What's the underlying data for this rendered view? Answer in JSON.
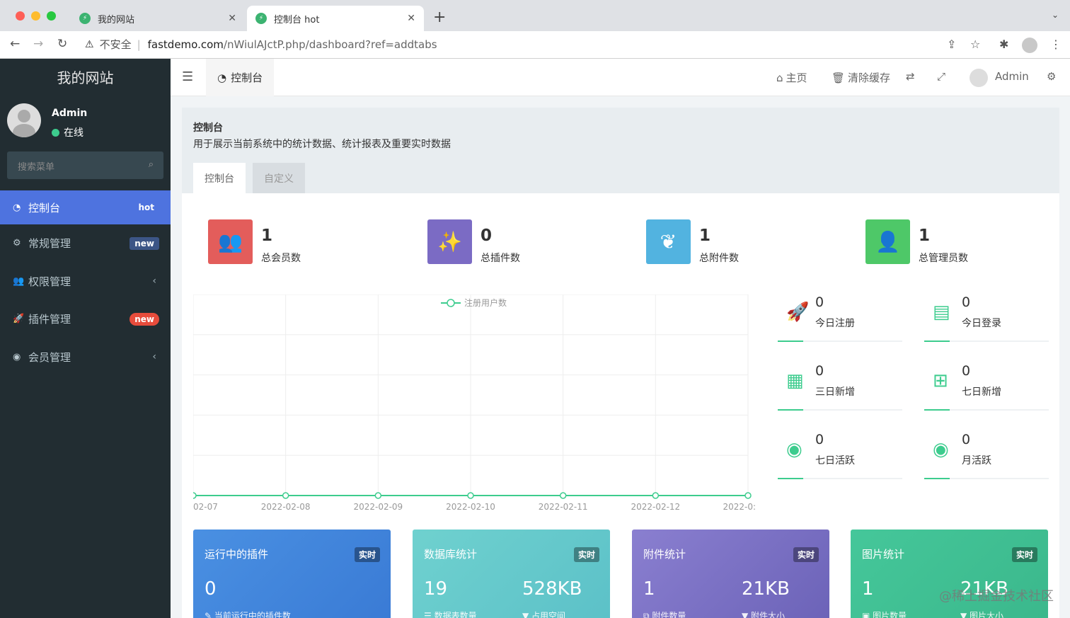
{
  "browser": {
    "tabs": [
      {
        "title": "我的网站"
      },
      {
        "title": "控制台 hot"
      }
    ],
    "url_insecure": "不安全",
    "url_domain": "fastdemo.com",
    "url_path": "/nWiulAJctP.php/dashboard?ref=addtabs"
  },
  "sidebar": {
    "logo": "我的网站",
    "user_name": "Admin",
    "user_status": "在线",
    "search_placeholder": "搜索菜单",
    "items": [
      {
        "label": "控制台",
        "badge": "hot"
      },
      {
        "label": "常规管理",
        "badge": "new"
      },
      {
        "label": "权限管理"
      },
      {
        "label": "插件管理",
        "badge": "new"
      },
      {
        "label": "会员管理"
      }
    ]
  },
  "header": {
    "tab": "控制台",
    "home": "主页",
    "clear_cache": "清除缓存",
    "admin": "Admin"
  },
  "panel": {
    "title": "控制台",
    "desc": "用于展示当前系统中的统计数据、统计报表及重要实时数据",
    "tabs": [
      "控制台",
      "自定义"
    ]
  },
  "stats": [
    {
      "num": "1",
      "label": "总会员数",
      "color": "#e35d5b"
    },
    {
      "num": "0",
      "label": "总插件数",
      "color": "#7b6bc4"
    },
    {
      "num": "1",
      "label": "总附件数",
      "color": "#52b3e0"
    },
    {
      "num": "1",
      "label": "总管理员数",
      "color": "#4ec868"
    }
  ],
  "mini_stats": [
    {
      "num": "0",
      "label": "今日注册",
      "icon": "rocket-icon"
    },
    {
      "num": "0",
      "label": "今日登录",
      "icon": "id-card-icon"
    },
    {
      "num": "0",
      "label": "三日新增",
      "icon": "calendar-icon"
    },
    {
      "num": "0",
      "label": "七日新增",
      "icon": "calendar-plus-icon"
    },
    {
      "num": "0",
      "label": "七日活跃",
      "icon": "user-circle-icon"
    },
    {
      "num": "0",
      "label": "月活跃",
      "icon": "user-circle-icon"
    }
  ],
  "chart_data": {
    "type": "line",
    "categories": [
      "02-07",
      "2022-02-08",
      "2022-02-09",
      "2022-02-10",
      "2022-02-11",
      "2022-02-12",
      "2022-0:"
    ],
    "series": [
      {
        "name": "注册用户数",
        "values": [
          0,
          0,
          0,
          0,
          0,
          0,
          0
        ]
      }
    ],
    "color": "#3dcc8e",
    "grid": true,
    "legend": "top-center"
  },
  "cards": [
    {
      "title": "运行中的插件",
      "tag": "实时",
      "v1": "0",
      "s1": "当前运行中的插件数",
      "v2": "",
      "s2": "",
      "color": "#4a90e2"
    },
    {
      "title": "数据库统计",
      "tag": "实时",
      "v1": "19",
      "s1": "数据表数量",
      "v2": "528KB",
      "s2": "占用空间",
      "color": "#6fd1cf"
    },
    {
      "title": "附件统计",
      "tag": "实时",
      "v1": "1",
      "s1": "附件数量",
      "v2": "21KB",
      "s2": "附件大小",
      "color": "#7a70c4"
    },
    {
      "title": "图片统计",
      "tag": "实时",
      "v1": "1",
      "s1": "图片数量",
      "v2": "21KB",
      "s2": "图片大小",
      "color": "#45c79a"
    }
  ],
  "watermark": "@稀土掘金技术社区"
}
